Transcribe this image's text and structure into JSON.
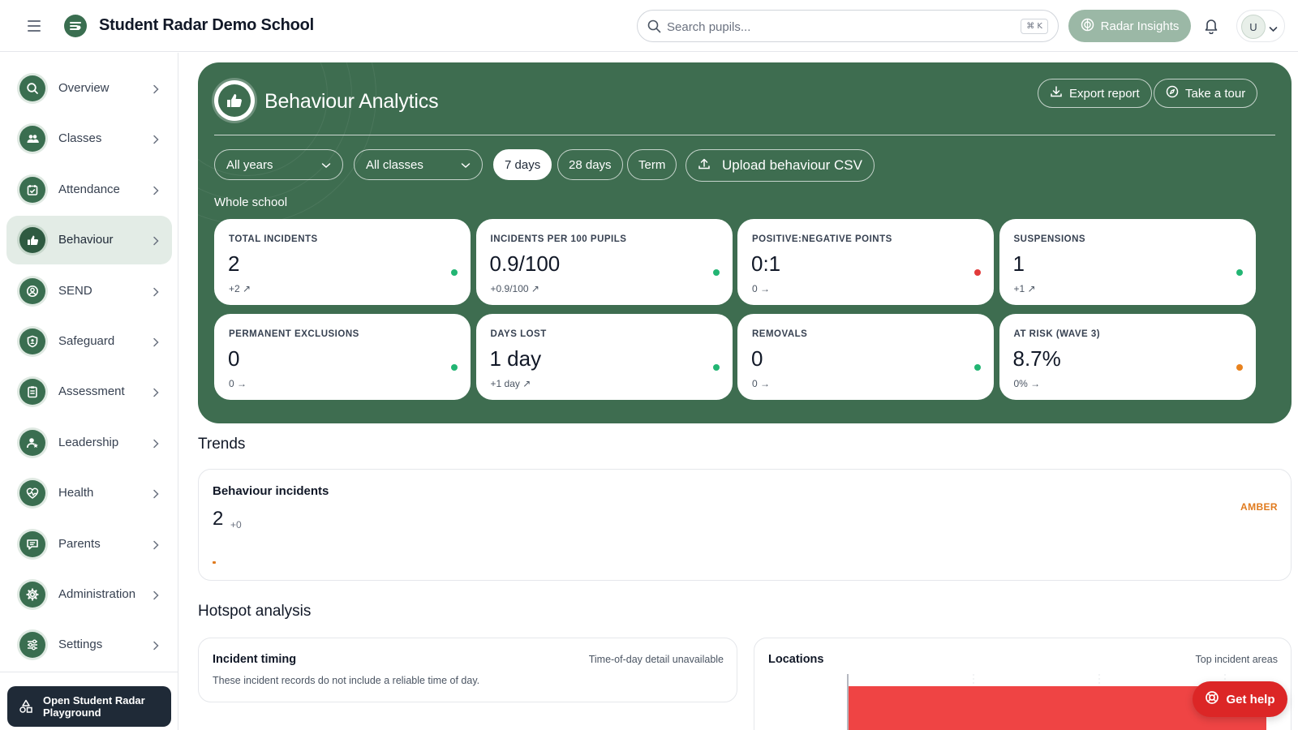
{
  "header": {
    "app_title": "Student Radar Demo School",
    "search_placeholder": "Search pupils...",
    "search_shortcut": "⌘ K",
    "insights_label": "Radar Insights",
    "user_initial": "U"
  },
  "sidebar": {
    "items": [
      {
        "label": "Overview",
        "icon": "search-icon"
      },
      {
        "label": "Classes",
        "icon": "users-icon"
      },
      {
        "label": "Attendance",
        "icon": "calendar-check-icon"
      },
      {
        "label": "Behaviour",
        "icon": "thumbs-up-icon",
        "active": true
      },
      {
        "label": "SEND",
        "icon": "user-circle-icon"
      },
      {
        "label": "Safeguard",
        "icon": "shield-user-icon"
      },
      {
        "label": "Assessment",
        "icon": "clipboard-list-icon"
      },
      {
        "label": "Leadership",
        "icon": "user-star-icon"
      },
      {
        "label": "Health",
        "icon": "heart-pulse-icon"
      },
      {
        "label": "Parents",
        "icon": "message-icon"
      },
      {
        "label": "Administration",
        "icon": "gear-icon"
      },
      {
        "label": "Settings",
        "icon": "sliders-icon"
      }
    ],
    "playground_label": "Open Student Radar Playground"
  },
  "hero": {
    "title": "Behaviour Analytics",
    "export_label": "Export report",
    "tour_label": "Take a tour",
    "filters": {
      "year_select": "All years",
      "class_select": "All classes",
      "periods": [
        "7 days",
        "28 days",
        "Term"
      ],
      "active_period": "7 days",
      "upload_label": "Upload behaviour CSV"
    },
    "scope": "Whole school",
    "stats": [
      {
        "label": "TOTAL INCIDENTS",
        "value": "2",
        "change": "+2 ↗",
        "status": "green"
      },
      {
        "label": "INCIDENTS PER 100 PUPILS",
        "value": "0.9/100",
        "change": "+0.9/100 ↗",
        "status": "green"
      },
      {
        "label": "POSITIVE:NEGATIVE POINTS",
        "value": "0:1",
        "change": "0 →",
        "status": "red"
      },
      {
        "label": "SUSPENSIONS",
        "value": "1",
        "change": "+1 ↗",
        "status": "green"
      },
      {
        "label": "PERMANENT EXCLUSIONS",
        "value": "0",
        "change": "0 →",
        "status": "green"
      },
      {
        "label": "DAYS LOST",
        "value": "1 day",
        "change": "+1 day ↗",
        "status": "green"
      },
      {
        "label": "REMOVALS",
        "value": "0",
        "change": "0 →",
        "status": "green"
      },
      {
        "label": "AT RISK (WAVE 3)",
        "value": "8.7%",
        "change": "0% →",
        "status": "amber"
      }
    ]
  },
  "trends": {
    "heading": "Trends",
    "card_title": "Behaviour incidents",
    "value": "2",
    "delta": "+0",
    "rag": "AMBER"
  },
  "hotspot": {
    "heading": "Hotspot analysis",
    "timing_title": "Incident timing",
    "timing_meta": "Time-of-day detail unavailable",
    "timing_desc": "These incident records do not include a reliable time of day.",
    "locations_title": "Locations",
    "locations_meta": "Top incident areas"
  },
  "help_label": "Get help",
  "colors": {
    "brand": "#3e6d50",
    "green": "#22b573",
    "red": "#e23a3a",
    "amber": "#e8821e",
    "help": "#dc2626",
    "bar": "#ef4444"
  }
}
